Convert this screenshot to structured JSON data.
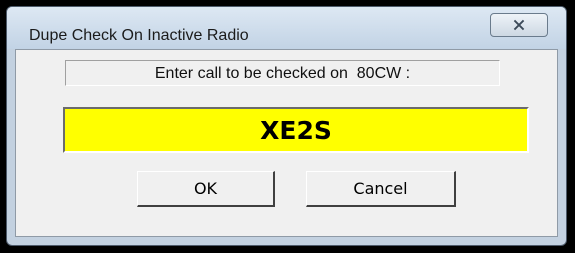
{
  "window": {
    "title": "Dupe Check On Inactive Radio"
  },
  "dialog": {
    "prompt": "Enter call to be checked on  80CW :",
    "call_value": "XE2S",
    "ok_label": "OK",
    "cancel_label": "Cancel"
  },
  "icons": {
    "close": "close-icon"
  },
  "colors": {
    "input_background": "#ffff00",
    "dialog_background": "#f0f0f0",
    "titlebar": "#c9d7e6"
  }
}
